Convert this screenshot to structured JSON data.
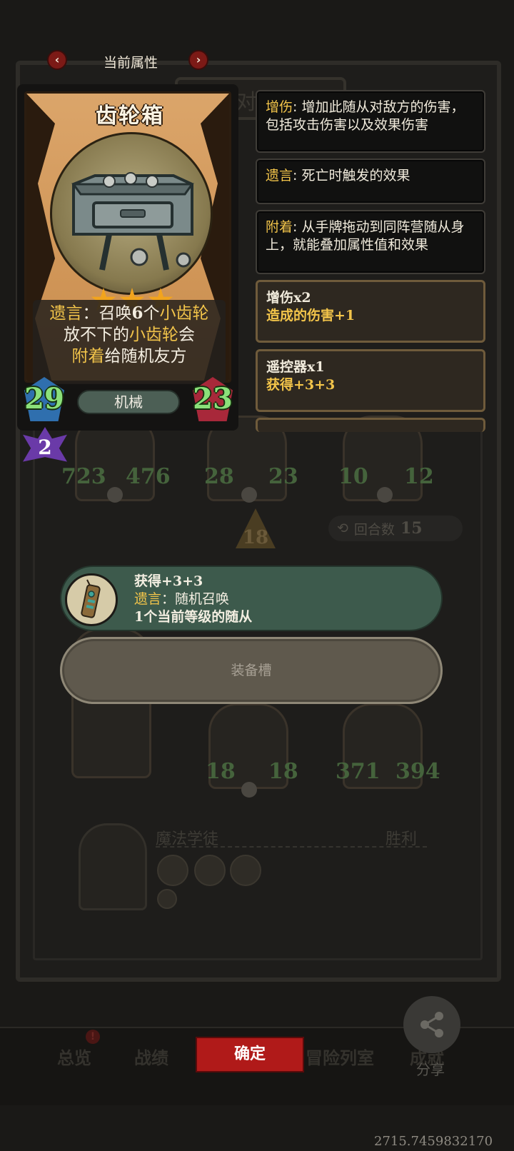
{
  "header": {
    "title": "当前属性",
    "prev_label": "‹",
    "next_label": "›"
  },
  "card": {
    "name": "齿轮箱",
    "stars": 3,
    "text": {
      "kw1": "遗言",
      "sep": "：",
      "p1": "召唤",
      "n1": "6",
      "p2": "个",
      "kw2": "小齿轮",
      "l2a": "放不下的",
      "kw3": "小齿轮",
      "l2b": "会",
      "kw4": "附着",
      "l3": "给随机友方"
    },
    "attack": "29",
    "health": "23",
    "tribe": "机械",
    "tier": "2"
  },
  "keywords": [
    {
      "name": "增伤",
      "sep": ": ",
      "desc": "增加此随从对敌方的伤害，包括攻击伤害以及效果伤害"
    },
    {
      "name": "遗言",
      "sep": ": ",
      "desc": "死亡时触发的效果"
    },
    {
      "name": "附着",
      "sep": ": ",
      "desc": "从手牌拖动到同阵营随从身上，就能叠加属性值和效果"
    }
  ],
  "buffs": [
    {
      "title": "增伤x2",
      "desc": "造成的伤害+1"
    },
    {
      "title": "遥控器x1",
      "desc": "获得+3+3"
    }
  ],
  "equipment": {
    "line1": "获得+3+3",
    "kw": "遗言",
    "sep": "：",
    "line2": "随机召唤",
    "line3": "1个当前等级的随从",
    "slot_label": "装备槽"
  },
  "background": {
    "title": "对局详情",
    "arrow_number": "18",
    "round_label": "回合数",
    "round_value": "15",
    "row1": [
      {
        "atk": "723",
        "hp": "476"
      },
      {
        "atk": "28",
        "hp": "23"
      },
      {
        "atk": "10",
        "hp": "12"
      }
    ],
    "row2": [
      {
        "atk": "18",
        "hp": "18"
      },
      {
        "atk": "371",
        "hp": "394"
      }
    ],
    "player_name": "魔法学徒",
    "player_result": "胜利",
    "tabs": [
      "总览",
      "战绩",
      "冒险列室",
      "成就"
    ],
    "share_label": "分享"
  },
  "confirm_label": "确定",
  "coords_text": "2715.7459832170",
  "colors": {
    "keyword": "#f2c44a",
    "stat_green": "#8be07a",
    "confirm": "#b01a19",
    "equip_banner": "#3d5a4c"
  }
}
